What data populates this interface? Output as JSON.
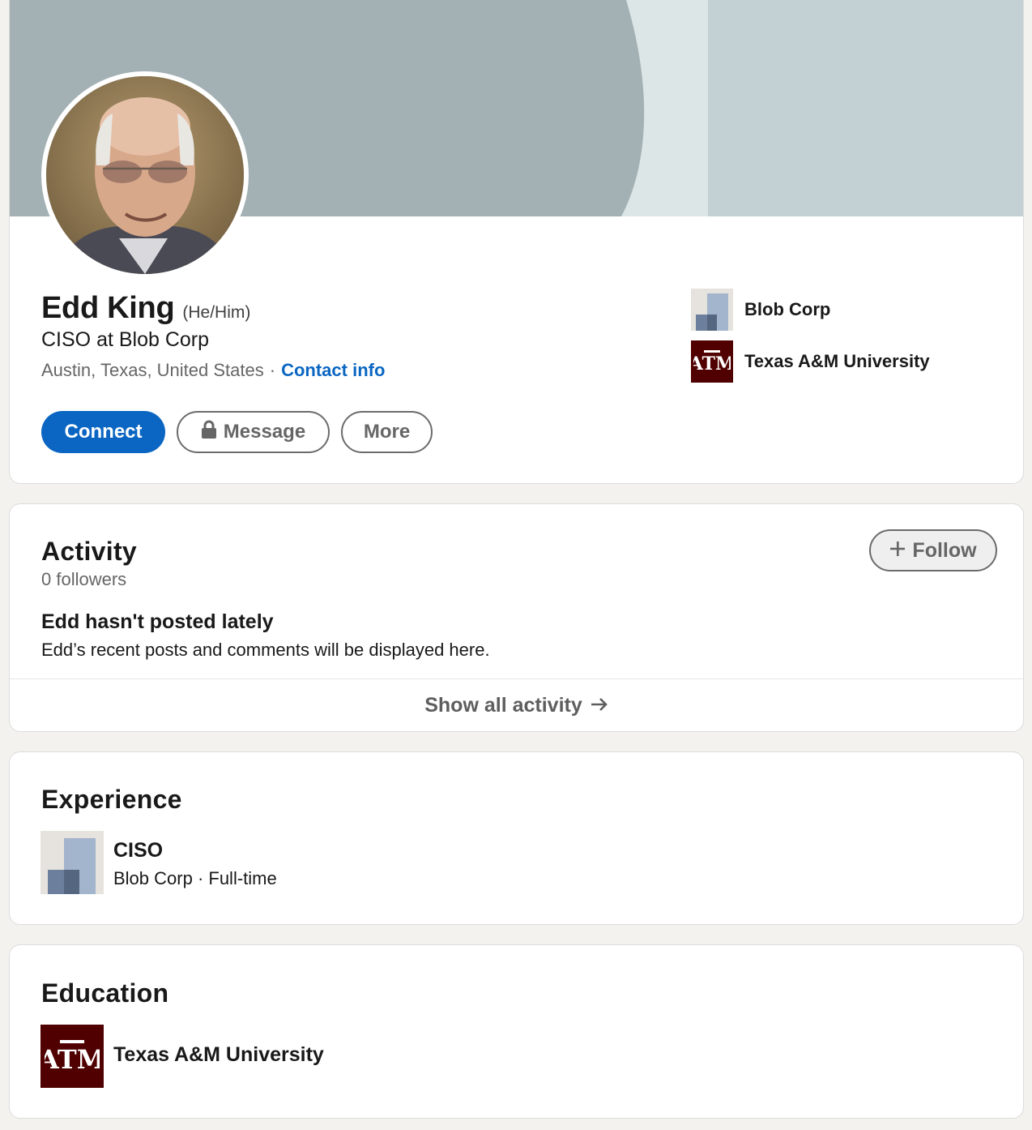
{
  "profile": {
    "name": "Edd King",
    "pronouns": "(He/Him)",
    "headline": "CISO at Blob Corp",
    "location": "Austin, Texas, United States",
    "separator": "·",
    "contact_info_label": "Contact info",
    "actions": {
      "connect_label": "Connect",
      "message_label": "Message",
      "more_label": "More"
    },
    "affiliations": [
      {
        "label": "Blob Corp",
        "logo": "blob-corp-logo"
      },
      {
        "label": "Texas A&M University",
        "logo": "texas-am-logo"
      }
    ]
  },
  "activity": {
    "title": "Activity",
    "followers": "0 followers",
    "follow_label": "Follow",
    "empty_title": "Edd hasn't posted lately",
    "empty_subtitle": "Edd’s recent posts and comments will be displayed here.",
    "show_all_label": "Show all activity"
  },
  "experience": {
    "title": "Experience",
    "items": [
      {
        "role": "CISO",
        "details": "Blob Corp · Full-time",
        "logo": "blob-corp-logo"
      }
    ]
  },
  "education": {
    "title": "Education",
    "items": [
      {
        "school": "Texas A&M University",
        "logo": "texas-am-logo"
      }
    ]
  },
  "colors": {
    "brand_blue": "#0a66c2",
    "tamu_maroon": "#500000",
    "banner_dark": "#a3b1b4",
    "banner_light": "#c3d1d4",
    "page_background": "#f3f2ef"
  }
}
